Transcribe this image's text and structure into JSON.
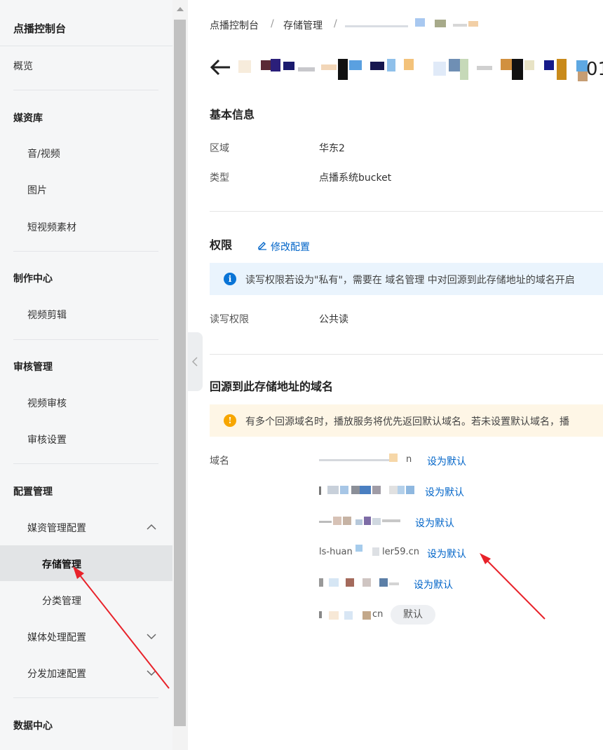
{
  "sidebar": {
    "title": "点播控制台",
    "overview": "概览",
    "sections": [
      {
        "title": "媒资库",
        "items": [
          "音/视频",
          "图片",
          "短视频素材"
        ]
      },
      {
        "title": "制作中心",
        "items": [
          "视频剪辑"
        ]
      },
      {
        "title": "审核管理",
        "items": [
          "视频审核",
          "审核设置"
        ]
      },
      {
        "title": "配置管理",
        "items": [
          "媒资管理配置",
          "存储管理",
          "分类管理",
          "媒体处理配置",
          "分发加速配置"
        ]
      },
      {
        "title": "数据中心",
        "items": []
      }
    ],
    "active_item": "存储管理"
  },
  "breadcrumb": [
    "点播控制台",
    "存储管理"
  ],
  "page_title_suffix": "01",
  "basic_info": {
    "heading": "基本信息",
    "rows": [
      {
        "label": "区域",
        "value": "华东2"
      },
      {
        "label": "类型",
        "value": "点播系统bucket"
      }
    ]
  },
  "permissions": {
    "heading": "权限",
    "edit_link": "修改配置",
    "alert": "读写权限若设为\"私有\"，需要在 域名管理 中对回源到此存储地址的域名开启",
    "rw_label": "读写权限",
    "rw_value": "公共读"
  },
  "domains": {
    "heading": "回源到此存储地址的域名",
    "alert": "有多个回源域名时，播放服务将优先返回默认域名。若未设置默认域名，播",
    "label": "域名",
    "rows": [
      {
        "visible_text": "n",
        "action": "设为默认"
      },
      {
        "visible_text": "",
        "action": "设为默认"
      },
      {
        "visible_text": "",
        "action": "设为默认"
      },
      {
        "visible_text": "ls-huan",
        "visible_suffix": "ler59.cn",
        "action": "设为默认"
      },
      {
        "visible_text": "",
        "action": "设为默认"
      },
      {
        "visible_text": "cn",
        "badge": "默认"
      }
    ]
  },
  "colors": {
    "brand_orange": "#ff6a00",
    "link_blue": "#0064c8",
    "info_bg": "#eaf4fd",
    "warn_bg": "#fef6e6",
    "info_icon": "#0a74d6",
    "warn_icon": "#f7a600",
    "annotation_red": "#e8222a"
  },
  "icons": {
    "back": "arrow-left-icon",
    "edit": "pencil-icon",
    "info": "info-circle-icon",
    "warning": "warning-circle-icon",
    "expand": "chevron-up-icon",
    "collapse": "chevron-down-icon",
    "collapse_sidebar": "chevron-left-icon"
  }
}
